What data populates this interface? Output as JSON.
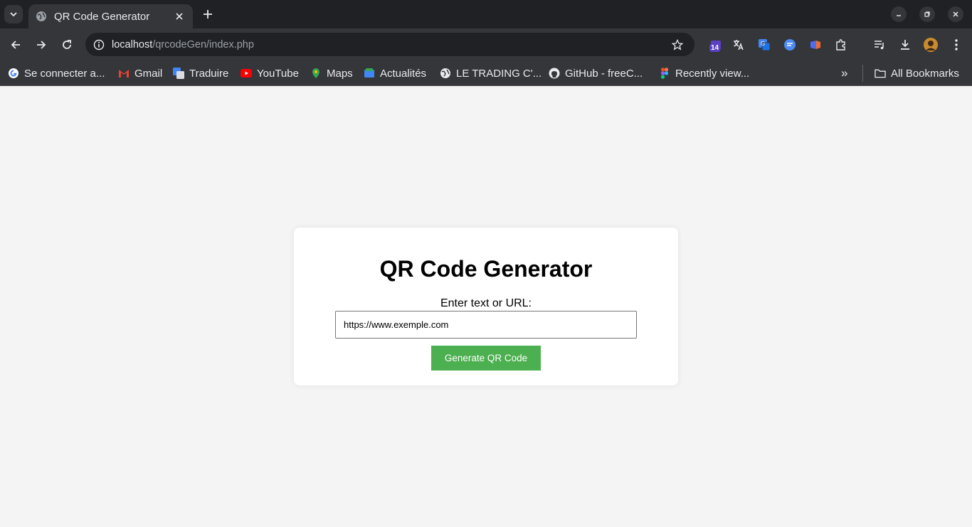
{
  "browser": {
    "tab_title": "QR Code Generator",
    "url_host": "localhost",
    "url_path": "/qrcodeGen/index.php",
    "extension_badge": "14",
    "bookmarks": [
      {
        "label": "Se connecter a...",
        "icon": "google-icon"
      },
      {
        "label": "Gmail",
        "icon": "gmail-icon"
      },
      {
        "label": "Traduire",
        "icon": "translate-icon"
      },
      {
        "label": "YouTube",
        "icon": "youtube-icon"
      },
      {
        "label": "Maps",
        "icon": "maps-icon"
      },
      {
        "label": "Actualités",
        "icon": "news-icon"
      },
      {
        "label": "LE TRADING C'...",
        "icon": "globe-icon"
      },
      {
        "label": "GitHub - freeC...",
        "icon": "github-icon"
      },
      {
        "label": "Recently view...",
        "icon": "figma-icon"
      }
    ],
    "all_bookmarks": "All Bookmarks",
    "overflow_chevron": "»"
  },
  "page": {
    "title": "QR Code Generator",
    "input_label": "Enter text or URL:",
    "input_value": "https://www.exemple.com",
    "button_label": "Generate QR Code"
  },
  "colors": {
    "button": "#4caf50",
    "page_bg": "#f4f4f4",
    "card_bg": "#ffffff"
  }
}
